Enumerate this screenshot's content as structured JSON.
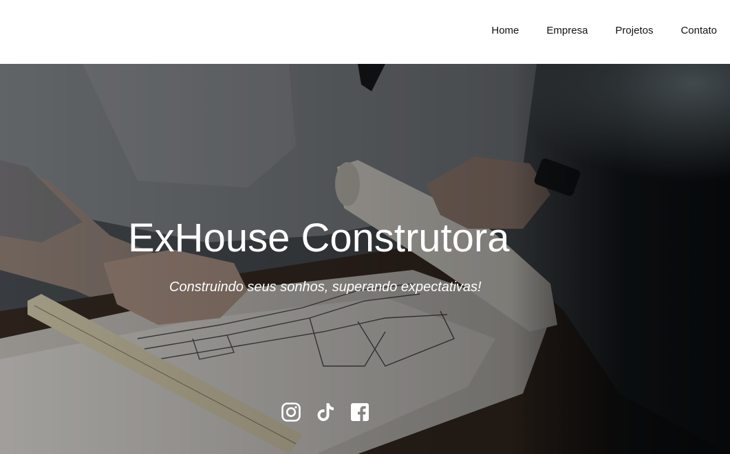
{
  "nav": {
    "items": [
      {
        "label": "Home"
      },
      {
        "label": "Empresa"
      },
      {
        "label": "Projetos"
      },
      {
        "label": "Contato"
      }
    ]
  },
  "hero": {
    "title": "ExHouse Construtora",
    "subtitle": "Construindo seus sonhos, superando expectativas!"
  },
  "socials": {
    "items": [
      {
        "icon": "instagram-icon"
      },
      {
        "icon": "tiktok-icon"
      },
      {
        "icon": "facebook-icon"
      }
    ]
  },
  "colors": {
    "text_dark": "#111111",
    "hero_text": "#ffffff"
  }
}
